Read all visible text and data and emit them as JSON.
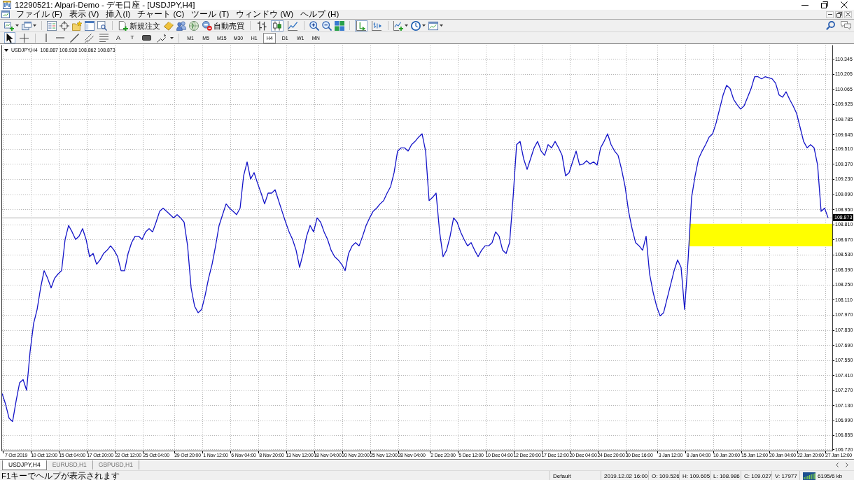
{
  "window": {
    "title": "12290521: Alpari-Demo - デモ口座 - [USDJPY,H4]"
  },
  "menu": [
    "ファイル (F)",
    "表示 (V)",
    "挿入(I)",
    "チャート (C)",
    "ツール (T)",
    "ウィンドウ (W)",
    "ヘルプ (H)"
  ],
  "toolbar": {
    "new_order_label": "新規注文",
    "autotrading_label": "自動売買",
    "chart_types": [
      {
        "kind": "bars",
        "selected": false
      },
      {
        "kind": "candles",
        "selected": true
      },
      {
        "kind": "line",
        "selected": false
      }
    ],
    "autoscroll": {
      "on": true
    },
    "chart_shift": {
      "on": false
    }
  },
  "drawing_toolbar": {
    "tools": [
      {
        "kind": "cursor",
        "selected": true
      },
      {
        "kind": "crosshair",
        "selected": false
      },
      {
        "kind": "vertical_line",
        "selected": false
      },
      {
        "kind": "horizontal_line",
        "selected": false
      },
      {
        "kind": "trendline",
        "selected": false
      },
      {
        "kind": "channel",
        "selected": false
      },
      {
        "kind": "fibonacci",
        "selected": false
      },
      {
        "kind": "text",
        "glyph": "A",
        "selected": false
      },
      {
        "kind": "label",
        "glyph": "T",
        "selected": false
      },
      {
        "kind": "rectangle",
        "selected": false
      },
      {
        "kind": "shapes",
        "selected": false
      }
    ],
    "timeframes": [
      {
        "label": "M1",
        "selected": false
      },
      {
        "label": "M5",
        "selected": false
      },
      {
        "label": "M15",
        "selected": false
      },
      {
        "label": "M30",
        "selected": false
      },
      {
        "label": "H1",
        "selected": false
      },
      {
        "label": "H4",
        "selected": true
      },
      {
        "label": "D1",
        "selected": false
      },
      {
        "label": "W1",
        "selected": false
      },
      {
        "label": "MN",
        "selected": false
      }
    ]
  },
  "chart": {
    "quote": "108.887 108.938 108.862 108.873",
    "chart_data": {
      "type": "line",
      "title": "USDJPY,H4",
      "grid": true,
      "ylim": [
        106.71,
        110.47
      ],
      "yticks": [
        110.345,
        110.205,
        110.065,
        109.925,
        109.785,
        109.645,
        {
          "value": 109.51,
          "label": "109.510"
        },
        {
          "value": 109.37,
          "label": "109.370"
        },
        {
          "value": 109.23,
          "label": "109.230"
        },
        {
          "value": 109.09,
          "label": "109.090"
        },
        {
          "value": 108.95,
          "label": "108.950"
        },
        {
          "value": 108.81,
          "label": "108.810"
        },
        {
          "value": 108.67,
          "label": "108.670"
        },
        {
          "value": 108.53,
          "label": "108.530"
        },
        {
          "value": 108.39,
          "label": "108.390"
        },
        {
          "value": 108.25,
          "label": "108.250"
        },
        {
          "value": 108.11,
          "label": "108.110"
        },
        {
          "value": 107.97,
          "label": "107.970"
        },
        {
          "value": 107.83,
          "label": "107.830"
        },
        {
          "value": 107.69,
          "label": "107.690"
        },
        {
          "value": 107.55,
          "label": "107.550"
        },
        {
          "value": 107.41,
          "label": "107.410"
        },
        {
          "value": 107.27,
          "label": "107.270"
        },
        {
          "value": 107.13,
          "label": "107.130"
        },
        {
          "value": 106.99,
          "label": "106.990"
        },
        106.855,
        {
          "value": 106.72,
          "label": "106.720"
        }
      ],
      "categories": [
        null,
        null,
        null,
        null,
        "7 Oct 2019",
        null,
        null,
        null,
        null,
        null,
        null,
        null,
        "10 Oct 12:00",
        null,
        null,
        null,
        null,
        null,
        null,
        null,
        "15 Oct 04:00",
        null,
        null,
        null,
        null,
        null,
        null,
        null,
        "17 Oct 20:00",
        null,
        null,
        null,
        null,
        null,
        null,
        null,
        "22 Oct 12:00",
        null,
        null,
        null,
        null,
        null,
        null,
        null,
        "25 Oct 04:00",
        null,
        null,
        null,
        null,
        null,
        null,
        null,
        null,
        "29 Oct 20:00",
        null,
        null,
        null,
        null,
        null,
        null,
        null,
        "1 Nov 12:00",
        null,
        null,
        null,
        null,
        null,
        null,
        null,
        "6 Nov 04:00",
        null,
        null,
        null,
        null,
        null,
        null,
        null,
        "8 Nov 20:00",
        null,
        null,
        null,
        null,
        null,
        null,
        null,
        "13 Nov 12:00",
        null,
        null,
        null,
        null,
        null,
        null,
        null,
        "18 Nov 04:00",
        null,
        null,
        null,
        null,
        null,
        null,
        null,
        "20 Nov 20:00",
        null,
        null,
        null,
        null,
        null,
        null,
        null,
        "25 Nov 12:00",
        null,
        null,
        null,
        null,
        null,
        null,
        null,
        "28 Nov 04:00",
        null,
        null,
        null,
        null,
        null,
        null,
        null,
        null,
        "2 Dec 20:00",
        null,
        null,
        null,
        null,
        null,
        null,
        null,
        "5 Dec 12:00",
        null,
        null,
        null,
        null,
        null,
        null,
        null,
        "10 Dec 04:00",
        null,
        null,
        null,
        null,
        null,
        null,
        null,
        "12 Dec 20:00",
        null,
        null,
        null,
        null,
        null,
        null,
        null,
        "17 Dec 12:00",
        null,
        null,
        null,
        null,
        null,
        null,
        null,
        "20 Dec 04:00",
        null,
        null,
        null,
        null,
        null,
        null,
        null,
        "24 Dec 20:00",
        null,
        null,
        null,
        null,
        null,
        null,
        null,
        "30 Dec 16:00",
        null,
        null,
        null,
        null,
        null,
        null,
        null,
        null,
        "3 Jan 12:00",
        null,
        null,
        null,
        null,
        null,
        null,
        null,
        "8 Jan 04:00",
        null,
        null,
        null,
        null,
        null,
        null,
        null,
        "10 Jan 20:00",
        null,
        null,
        null,
        null,
        null,
        null,
        null,
        "15 Jan 12:00",
        null,
        null,
        null,
        null,
        null,
        null,
        null,
        "20 Jan 04:00",
        null,
        null,
        null,
        null,
        null,
        null,
        null,
        "22 Jan 20:00",
        null,
        null,
        null,
        null,
        null,
        null,
        null,
        "27 Jan 12:00"
      ],
      "series": [
        {
          "color": "#1414c8",
          "values": [
            107.24,
            107.14,
            107.01,
            106.98,
            107.17,
            107.34,
            107.37,
            107.27,
            107.63,
            107.89,
            108.02,
            108.22,
            108.38,
            108.31,
            108.22,
            108.31,
            108.35,
            108.38,
            108.67,
            108.8,
            108.74,
            108.67,
            108.7,
            108.77,
            108.67,
            108.51,
            108.54,
            108.44,
            108.48,
            108.54,
            108.57,
            108.61,
            108.57,
            108.51,
            108.38,
            108.38,
            108.54,
            108.64,
            108.7,
            108.7,
            108.67,
            108.74,
            108.77,
            108.74,
            108.83,
            108.93,
            108.96,
            108.93,
            108.9,
            108.87,
            108.9,
            108.87,
            108.83,
            108.61,
            108.22,
            108.05,
            107.99,
            108.02,
            108.15,
            108.31,
            108.44,
            108.61,
            108.8,
            108.9,
            109.0,
            108.96,
            108.93,
            108.9,
            108.96,
            109.26,
            109.39,
            109.23,
            109.29,
            109.19,
            109.1,
            109.0,
            109.1,
            109.1,
            109.13,
            109.03,
            108.93,
            108.83,
            108.74,
            108.67,
            108.57,
            108.41,
            108.54,
            108.7,
            108.8,
            108.74,
            108.87,
            108.83,
            108.74,
            108.67,
            108.57,
            108.51,
            108.48,
            108.44,
            108.38,
            108.54,
            108.61,
            108.64,
            108.61,
            108.7,
            108.8,
            108.87,
            108.93,
            108.96,
            109.0,
            109.03,
            109.1,
            109.16,
            109.29,
            109.49,
            109.52,
            109.52,
            109.49,
            109.55,
            109.58,
            109.62,
            109.65,
            109.49,
            109.03,
            109.06,
            109.1,
            108.74,
            108.51,
            108.57,
            108.7,
            108.87,
            108.83,
            108.74,
            108.67,
            108.61,
            108.64,
            108.57,
            108.51,
            108.57,
            108.61,
            108.61,
            108.64,
            108.74,
            108.7,
            108.57,
            108.54,
            108.64,
            109.06,
            109.55,
            109.58,
            109.42,
            109.32,
            109.42,
            109.52,
            109.58,
            109.49,
            109.45,
            109.55,
            109.52,
            109.58,
            109.52,
            109.45,
            109.26,
            109.29,
            109.39,
            109.49,
            109.36,
            109.37,
            109.4,
            109.37,
            109.39,
            109.36,
            109.52,
            109.58,
            109.65,
            109.55,
            109.49,
            109.45,
            109.32,
            109.16,
            108.93,
            108.77,
            108.64,
            108.61,
            108.57,
            108.7,
            108.35,
            108.18,
            108.05,
            107.96,
            107.99,
            108.12,
            108.25,
            108.38,
            108.48,
            108.41,
            108.02,
            108.48,
            109.06,
            109.26,
            109.42,
            109.49,
            109.55,
            109.62,
            109.65,
            109.75,
            109.88,
            110.01,
            110.1,
            110.07,
            109.97,
            109.92,
            109.88,
            109.91,
            109.99,
            110.07,
            110.18,
            110.18,
            110.16,
            110.18,
            110.17,
            110.16,
            110.12,
            110.01,
            109.99,
            110.04,
            109.97,
            109.91,
            109.84,
            109.71,
            109.58,
            109.52,
            109.55,
            109.52,
            109.36,
            108.93,
            108.96,
            108.87,
            null,
            null,
            null
          ]
        }
      ],
      "ref_lines": [
        {
          "axis": "y",
          "value": 108.873,
          "label": "108.873"
        }
      ]
    }
  },
  "tabs": [
    {
      "label": "USDJPY,H4",
      "selected": true
    },
    {
      "label": "EURUSD,H1",
      "selected": false
    },
    {
      "label": "GBPUSD,H1",
      "selected": false
    }
  ],
  "status_bar": {
    "help_text": "F1キーでヘルプが表示されます",
    "fields": [
      {
        "kind": "profile",
        "text": "Default"
      },
      {
        "kind": "time",
        "text": "2019.12.02 16:00"
      },
      {
        "kind": "open",
        "text": "O: 109.526"
      },
      {
        "kind": "high",
        "text": "H: 109.605"
      },
      {
        "kind": "low",
        "text": "L: 108.986"
      },
      {
        "kind": "close",
        "text": "C: 109.027"
      },
      {
        "kind": "volume",
        "text": "V: 17977"
      },
      {
        "kind": "traffic",
        "text": "6195/6 kb"
      }
    ]
  }
}
